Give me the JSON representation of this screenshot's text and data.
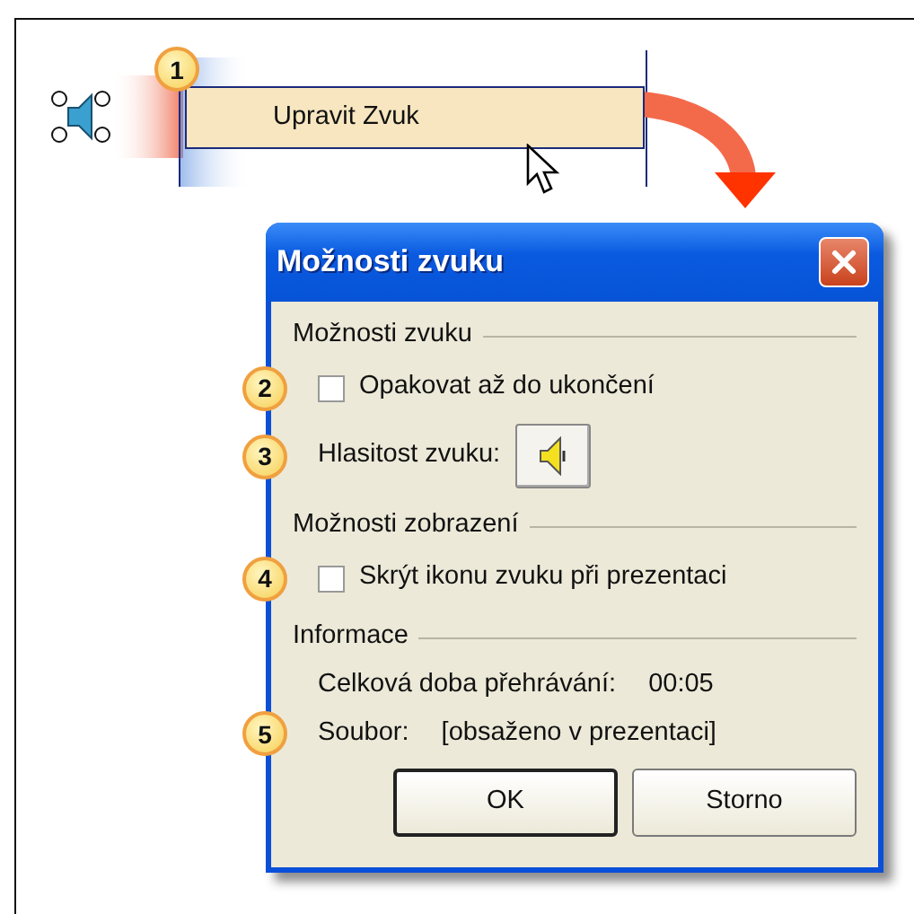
{
  "menu_item": {
    "callout": "1",
    "label": "Upravit Zvuk"
  },
  "dialog": {
    "title": "Možnosti zvuku",
    "sections": [
      {
        "heading": "Možnosti zvuku",
        "rows": [
          {
            "kind": "checkbox",
            "callout": "2",
            "label": "Opakovat až do ukončení",
            "checked": false
          },
          {
            "kind": "volume",
            "callout": "3",
            "label": "Hlasitost zvuku:"
          }
        ]
      },
      {
        "heading": "Možnosti zobrazení",
        "rows": [
          {
            "kind": "checkbox",
            "callout": "4",
            "label": "Skrýt ikonu zvuku při prezentaci",
            "checked": false
          }
        ]
      },
      {
        "heading": "Informace",
        "rows": [
          {
            "kind": "info",
            "label": "Celková doba přehrávání:",
            "value": "00:05"
          },
          {
            "kind": "info",
            "callout": "5",
            "label": "Soubor:",
            "value": "[obsaženo v prezentaci]"
          }
        ]
      }
    ],
    "buttons": [
      {
        "label": "OK",
        "default": true
      },
      {
        "label": "Storno",
        "default": false
      }
    ]
  }
}
